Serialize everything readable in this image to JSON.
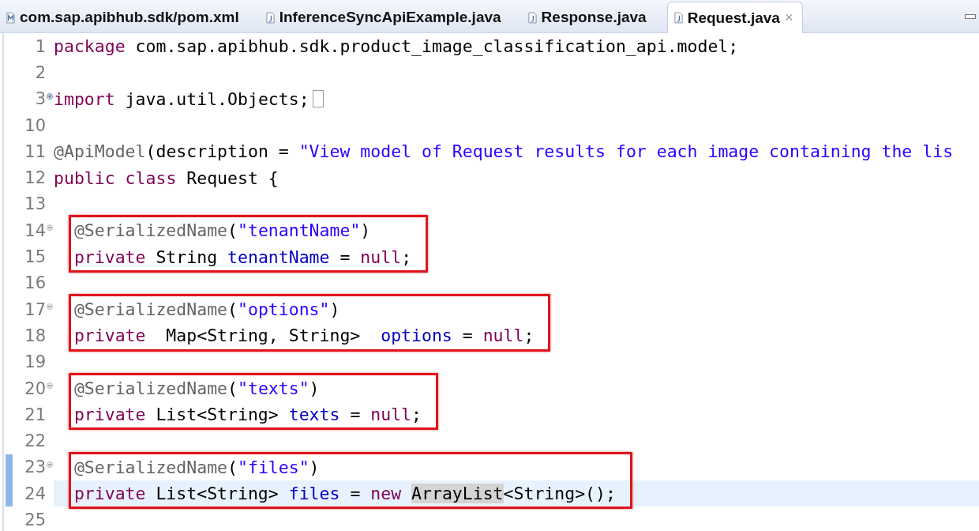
{
  "tabs": [
    {
      "label": "com.sap.apibhub.sdk/pom.xml",
      "kind": "xml",
      "selected": false
    },
    {
      "label": "InferenceSyncApiExample.java",
      "kind": "java",
      "selected": false
    },
    {
      "label": "Response.java",
      "kind": "java",
      "selected": false
    },
    {
      "label": "Request.java",
      "kind": "java",
      "selected": true,
      "close": "×"
    }
  ],
  "blocks": [
    {
      "kind": "plain",
      "lines": [
        {
          "number": "1",
          "kind": "plain",
          "changed": false,
          "current": false,
          "tokens": [
            {
              "kind": "keyword",
              "text": "package"
            },
            {
              "kind": "plain",
              "text": " com.sap.apibhub.sdk.product_image_classification_api.model;"
            }
          ]
        },
        {
          "number": "2",
          "kind": "plain",
          "changed": false,
          "current": false
        },
        {
          "number": "3",
          "kind": "foldable",
          "collapsed": true,
          "changed": false,
          "current": false,
          "folded_box": true,
          "tokens": [
            {
              "kind": "keyword",
              "text": "import"
            },
            {
              "kind": "plain",
              "text": " java.util.Objects;"
            }
          ]
        },
        {
          "number": "10",
          "kind": "plain",
          "changed": false,
          "current": false
        },
        {
          "number": "11",
          "kind": "plain",
          "changed": false,
          "current": false,
          "tokens": [
            {
              "kind": "annotation",
              "text": "@ApiModel"
            },
            {
              "kind": "plain",
              "text": "(description = "
            },
            {
              "kind": "string",
              "text": "\"View model of Request results for each image containing the lis"
            }
          ]
        },
        {
          "number": "12",
          "kind": "plain",
          "changed": false,
          "current": false,
          "tokens": [
            {
              "kind": "keyword",
              "text": "public"
            },
            {
              "kind": "keyword",
              "text": " class"
            },
            {
              "kind": "plain",
              "text": " Request {"
            }
          ]
        },
        {
          "number": "13",
          "kind": "plain",
          "changed": false,
          "current": false
        }
      ]
    },
    {
      "kind": "boxed",
      "lines": [
        {
          "number": "14",
          "kind": "foldable",
          "collapsed": false,
          "changed": false,
          "current": false,
          "tokens": [
            {
              "kind": "annotation",
              "text": "@SerializedName"
            },
            {
              "kind": "plain",
              "text": "("
            },
            {
              "kind": "string",
              "text": "\"tenantName\""
            },
            {
              "kind": "plain",
              "text": ")"
            }
          ]
        },
        {
          "number": "15",
          "kind": "plain",
          "changed": false,
          "current": false,
          "tokens": [
            {
              "kind": "keyword",
              "text": "private"
            },
            {
              "kind": "plain",
              "text": " String "
            },
            {
              "kind": "field",
              "text": "tenantName"
            },
            {
              "kind": "plain",
              "text": " = "
            },
            {
              "kind": "keyword",
              "text": "null"
            },
            {
              "kind": "plain",
              "text": ";"
            }
          ]
        }
      ]
    },
    {
      "kind": "plain",
      "lines": [
        {
          "number": "16",
          "kind": "plain",
          "changed": false,
          "current": false
        }
      ]
    },
    {
      "kind": "boxed",
      "lines": [
        {
          "number": "17",
          "kind": "foldable",
          "collapsed": false,
          "changed": false,
          "current": false,
          "tokens": [
            {
              "kind": "annotation",
              "text": "@SerializedName"
            },
            {
              "kind": "plain",
              "text": "("
            },
            {
              "kind": "string",
              "text": "\"options\""
            },
            {
              "kind": "plain",
              "text": ")"
            }
          ]
        },
        {
          "number": "18",
          "kind": "plain",
          "changed": false,
          "current": false,
          "tokens": [
            {
              "kind": "keyword",
              "text": "private"
            },
            {
              "kind": "plain",
              "text": "  Map<String, String>  "
            },
            {
              "kind": "field",
              "text": "options"
            },
            {
              "kind": "plain",
              "text": " = "
            },
            {
              "kind": "keyword",
              "text": "null"
            },
            {
              "kind": "plain",
              "text": ";"
            }
          ]
        }
      ]
    },
    {
      "kind": "plain",
      "lines": [
        {
          "number": "19",
          "kind": "plain",
          "changed": false,
          "current": false
        }
      ]
    },
    {
      "kind": "boxed",
      "lines": [
        {
          "number": "20",
          "kind": "foldable",
          "collapsed": false,
          "changed": false,
          "current": false,
          "tokens": [
            {
              "kind": "annotation",
              "text": "@SerializedName"
            },
            {
              "kind": "plain",
              "text": "("
            },
            {
              "kind": "string",
              "text": "\"texts\""
            },
            {
              "kind": "plain",
              "text": ")"
            }
          ]
        },
        {
          "number": "21",
          "kind": "plain",
          "changed": false,
          "current": false,
          "tokens": [
            {
              "kind": "keyword",
              "text": "private"
            },
            {
              "kind": "plain",
              "text": " List<String> "
            },
            {
              "kind": "field",
              "text": "texts"
            },
            {
              "kind": "plain",
              "text": " = "
            },
            {
              "kind": "keyword",
              "text": "null"
            },
            {
              "kind": "plain",
              "text": ";"
            }
          ]
        }
      ]
    },
    {
      "kind": "plain",
      "lines": [
        {
          "number": "22",
          "kind": "plain",
          "changed": false,
          "current": false
        }
      ]
    },
    {
      "kind": "boxed",
      "lines": [
        {
          "number": "23",
          "kind": "foldable",
          "collapsed": false,
          "changed": true,
          "current": false,
          "tokens": [
            {
              "kind": "annotation",
              "text": "@SerializedName"
            },
            {
              "kind": "plain",
              "text": "("
            },
            {
              "kind": "string",
              "text": "\"files\""
            },
            {
              "kind": "plain",
              "text": ")"
            }
          ]
        },
        {
          "number": "24",
          "kind": "plain",
          "changed": true,
          "current": true,
          "tokens": [
            {
              "kind": "keyword",
              "text": "private"
            },
            {
              "kind": "plain",
              "text": " List<String> "
            },
            {
              "kind": "field",
              "text": "files"
            },
            {
              "kind": "plain",
              "text": " = "
            },
            {
              "kind": "keyword",
              "text": "new "
            },
            {
              "kind": "occurrence",
              "text": "ArrayList"
            },
            {
              "kind": "plain",
              "text": "<String>();"
            }
          ]
        }
      ]
    },
    {
      "kind": "plain",
      "lines": [
        {
          "number": "25",
          "kind": "plain",
          "changed": false,
          "current": false
        }
      ]
    }
  ]
}
